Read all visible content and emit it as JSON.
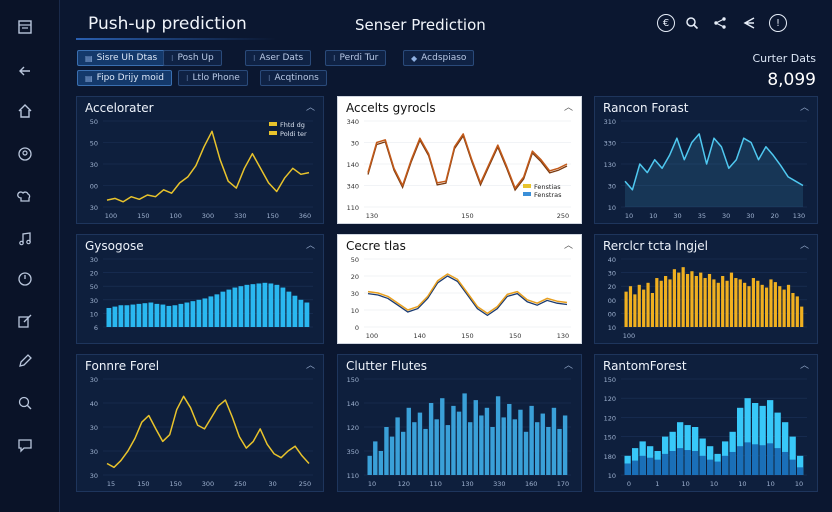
{
  "app": {
    "title": "Push-up prediction",
    "center_title": "Senser Prediction"
  },
  "topbar_icons": [
    "info-circle-icon",
    "search-icon",
    "share-icon",
    "back-arrow-icon",
    "alert-icon"
  ],
  "filters": [
    {
      "label": "Sisre Uh Dtas",
      "active": true
    },
    {
      "label": "Posh Up",
      "active": false
    },
    {
      "label": "Aser Dats",
      "active": false
    },
    {
      "label": "Perdi Tur",
      "active": false
    },
    {
      "label": "Acdspiaso",
      "active": false
    },
    {
      "label": "Fipo Drijy moid",
      "active": true
    },
    {
      "label": "Ltlo Phone",
      "active": false
    },
    {
      "label": "Acqtinons",
      "active": false
    }
  ],
  "metric": {
    "label": "Curter Dats",
    "value": "8,099"
  },
  "panels": [
    {
      "title": "Accelorater",
      "theme": "dark",
      "color": "#e8c32c",
      "type": "line",
      "legend": [
        "Fhtd dg",
        "Poldi ter"
      ],
      "legend_colors": [
        "#e8c32c",
        "#e8c32c"
      ],
      "y_ticks": [
        "50",
        "50",
        "30",
        "00",
        "30"
      ],
      "x_ticks": [
        "100",
        "150",
        "100",
        "300",
        "330",
        "150",
        "360"
      ],
      "values": [
        8,
        10,
        6,
        12,
        9,
        14,
        12,
        20,
        16,
        28,
        35,
        48,
        70,
        88,
        55,
        30,
        22,
        45,
        62,
        45,
        28,
        18,
        34,
        45,
        38,
        40
      ],
      "ylim": [
        0,
        100
      ]
    },
    {
      "title": "Accelts gyrocls",
      "theme": "light",
      "color": "#c25a1a",
      "type": "line2",
      "color2": "#7a3a10",
      "legend": [
        "Fenstias",
        "Fenstras"
      ],
      "legend_colors": [
        "#e8c32c",
        "#3a8fd8"
      ],
      "y_ticks": [
        "340",
        "30",
        "140",
        "340",
        "110"
      ],
      "x_ticks": [
        "130",
        "150",
        "250"
      ],
      "values": [
        40,
        75,
        78,
        45,
        25,
        55,
        80,
        62,
        28,
        30,
        70,
        85,
        55,
        28,
        50,
        72,
        48,
        22,
        35,
        65,
        55,
        42,
        45,
        50
      ],
      "ylim": [
        0,
        100
      ]
    },
    {
      "title": "Rancon Forast",
      "theme": "dark",
      "color": "#4fc8f0",
      "type": "area",
      "legend": [],
      "legend_colors": [],
      "y_ticks": [
        "310",
        "330",
        "130",
        "30",
        "10"
      ],
      "x_ticks": [
        "10",
        "10",
        "30",
        "35",
        "30",
        "30",
        "20",
        "130"
      ],
      "values": [
        30,
        20,
        50,
        40,
        55,
        45,
        60,
        80,
        55,
        75,
        85,
        50,
        80,
        70,
        45,
        55,
        80,
        75,
        55,
        70,
        60,
        48,
        35,
        30,
        25
      ],
      "ylim": [
        0,
        100
      ]
    },
    {
      "title": "Gysogose",
      "theme": "dark",
      "color": "#2ab8f0",
      "type": "bar",
      "legend": [],
      "legend_colors": [],
      "y_ticks": [
        "30",
        "20",
        "50",
        "30",
        "10",
        "6"
      ],
      "x_ticks": [],
      "values": [
        28,
        30,
        32,
        32,
        33,
        34,
        35,
        36,
        34,
        33,
        31,
        32,
        34,
        36,
        38,
        40,
        42,
        45,
        48,
        52,
        55,
        58,
        60,
        62,
        63,
        64,
        65,
        64,
        62,
        58,
        52,
        46,
        40,
        36
      ],
      "ylim": [
        0,
        100
      ]
    },
    {
      "title": "Cecre tlas",
      "theme": "light",
      "color": "#e8a020",
      "type": "line2",
      "color2": "#1a3a70",
      "legend": [],
      "legend_colors": [],
      "y_ticks": [
        "50",
        "20",
        "30",
        "10",
        "0"
      ],
      "x_ticks": [
        "100",
        "140",
        "150",
        "150",
        "130"
      ],
      "values": [
        52,
        50,
        45,
        35,
        25,
        30,
        45,
        68,
        78,
        70,
        50,
        30,
        20,
        30,
        48,
        52,
        40,
        35,
        42,
        38,
        36
      ],
      "ylim": [
        0,
        100
      ]
    },
    {
      "title": "Rerclcr tcta lngjel",
      "theme": "dark",
      "color": "#f0b020",
      "type": "bar",
      "legend": [],
      "legend_colors": [],
      "y_ticks": [
        "40",
        "30",
        "20",
        "00",
        "00",
        "10"
      ],
      "x_ticks": [
        "100"
      ],
      "values": [
        52,
        60,
        48,
        62,
        55,
        65,
        50,
        72,
        68,
        75,
        70,
        85,
        80,
        88,
        78,
        82,
        75,
        80,
        72,
        78,
        70,
        65,
        75,
        68,
        80,
        72,
        70,
        65,
        60,
        72,
        68,
        62,
        58,
        70,
        66,
        60,
        55,
        62,
        50,
        45,
        30
      ],
      "ylim": [
        0,
        100
      ]
    },
    {
      "title": "Fonnre Forel",
      "theme": "dark",
      "color": "#e8c32c",
      "type": "line",
      "legend": [],
      "legend_colors": [],
      "y_ticks": [
        "30",
        "40",
        "30",
        "30",
        "30"
      ],
      "x_ticks": [
        "15",
        "150",
        "150",
        "300",
        "250",
        "30",
        "250"
      ],
      "values": [
        12,
        8,
        15,
        25,
        38,
        55,
        62,
        48,
        35,
        42,
        68,
        82,
        70,
        52,
        48,
        60,
        72,
        78,
        60,
        40,
        28,
        35,
        48,
        32,
        22,
        18,
        25,
        30,
        20,
        12
      ],
      "ylim": [
        0,
        100
      ]
    },
    {
      "title": "Clutter Flutes",
      "theme": "dark",
      "color": "#3aa0d8",
      "type": "bar",
      "legend": [],
      "legend_colors": [],
      "y_ticks": [
        "150",
        "140",
        "120",
        "350",
        "110"
      ],
      "x_ticks": [
        "10",
        "120",
        "110",
        "130",
        "330",
        "160",
        "170"
      ],
      "values": [
        20,
        35,
        25,
        50,
        40,
        60,
        45,
        70,
        55,
        65,
        48,
        75,
        58,
        80,
        52,
        72,
        66,
        85,
        55,
        78,
        62,
        70,
        50,
        82,
        60,
        74,
        58,
        68,
        45,
        72,
        55,
        64,
        50,
        70,
        48,
        62
      ],
      "ylim": [
        0,
        100
      ]
    },
    {
      "title": "RantomForest",
      "theme": "dark",
      "color": "#38c8f8",
      "type": "bar2",
      "color2": "#1a6fb8",
      "legend": [],
      "legend_colors": [],
      "y_ticks": [
        "150",
        "120",
        "120",
        "150",
        "180",
        "10"
      ],
      "x_ticks": [
        "0",
        "1",
        "10",
        "10",
        "10",
        "10",
        "10"
      ],
      "values": [
        20,
        28,
        35,
        30,
        25,
        40,
        45,
        55,
        52,
        50,
        38,
        30,
        22,
        35,
        45,
        70,
        80,
        75,
        72,
        78,
        65,
        55,
        40,
        20
      ],
      "values2": [
        12,
        15,
        20,
        18,
        16,
        22,
        25,
        28,
        26,
        25,
        20,
        16,
        14,
        20,
        24,
        30,
        34,
        32,
        31,
        33,
        28,
        24,
        16,
        8
      ],
      "ylim": [
        0,
        100
      ]
    }
  ]
}
